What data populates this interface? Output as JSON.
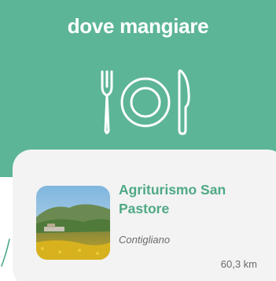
{
  "header": {
    "title": "dove mangiare",
    "icon": "fork-plate-knife-icon",
    "background_color": "#5cb596",
    "text_color": "#ffffff"
  },
  "places": [
    {
      "name": "Agriturismo San Pastore",
      "town": "Contigliano",
      "distance": "60,3 km",
      "thumbnail": "landscape-photo",
      "name_color": "#4fa985"
    }
  ]
}
